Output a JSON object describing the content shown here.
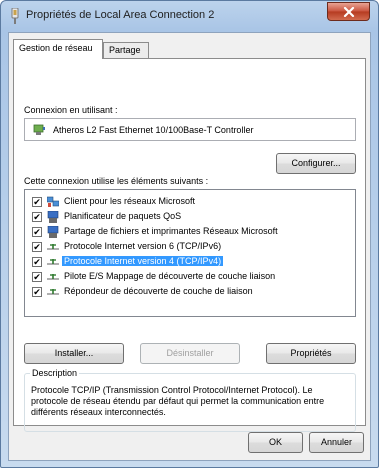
{
  "window": {
    "title": "Propriétés de Local Area Connection 2",
    "close_glyph": "X"
  },
  "tabs": [
    {
      "label": "Gestion de réseau",
      "active": true
    },
    {
      "label": "Partage",
      "active": false
    }
  ],
  "connection": {
    "label": "Connexion en utilisant :",
    "adapter": "Atheros L2 Fast Ethernet 10/100Base-T Controller",
    "configure_button": "Configurer..."
  },
  "items_section": {
    "label": "Cette connexion utilise les éléments suivants :",
    "items": [
      {
        "label": "Client pour les réseaux Microsoft",
        "checked": true,
        "icon": "network-client-icon",
        "selected": false
      },
      {
        "label": "Planificateur de paquets QoS",
        "checked": true,
        "icon": "network-service-icon",
        "selected": false
      },
      {
        "label": "Partage de fichiers et imprimantes Réseaux Microsoft",
        "checked": true,
        "icon": "network-service-icon",
        "selected": false
      },
      {
        "label": "Protocole Internet version 6 (TCP/IPv6)",
        "checked": true,
        "icon": "protocol-icon",
        "selected": false
      },
      {
        "label": "Protocole Internet version 4 (TCP/IPv4)",
        "checked": true,
        "icon": "protocol-icon",
        "selected": true
      },
      {
        "label": "Pilote E/S Mappage de découverte de couche liaison",
        "checked": true,
        "icon": "protocol-icon",
        "selected": false
      },
      {
        "label": "Répondeur de découverte de couche de liaison",
        "checked": true,
        "icon": "protocol-icon",
        "selected": false
      }
    ],
    "check_glyph": "✔"
  },
  "buttons": {
    "install": "Installer...",
    "uninstall": "Désinstaller",
    "properties": "Propriétés",
    "ok": "OK",
    "cancel": "Annuler"
  },
  "description": {
    "legend": "Description",
    "text": "Protocole TCP/IP (Transmission Control Protocol/Internet Protocol). Le protocole de réseau étendu par défaut qui permet la communication entre différents réseaux interconnectés."
  },
  "colors": {
    "selection": "#3399ff",
    "title_bar": "#bcd3ec",
    "close_button": "#c9533d"
  }
}
